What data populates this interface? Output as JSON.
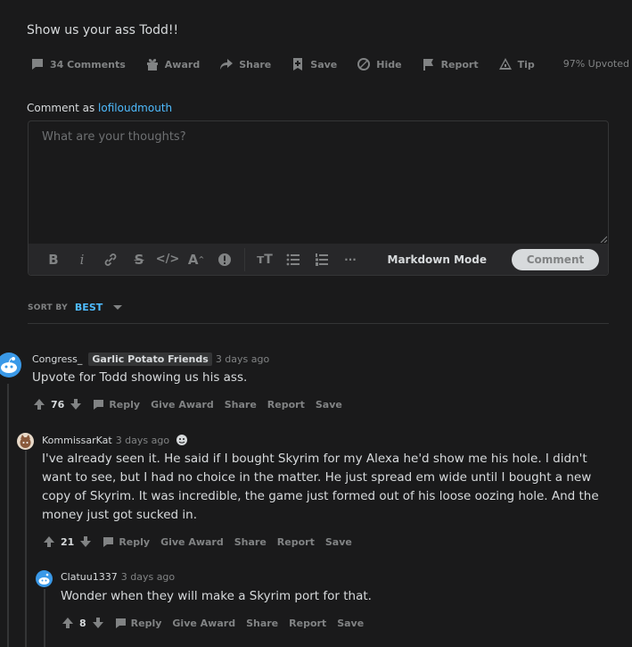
{
  "post": {
    "title": "Show us your ass Todd!!",
    "actions": [
      {
        "icon": "comment-icon",
        "label": "34 Comments"
      },
      {
        "icon": "gift-icon",
        "label": "Award"
      },
      {
        "icon": "share-arrow-icon",
        "label": "Share"
      },
      {
        "icon": "bookmark-icon",
        "label": "Save"
      },
      {
        "icon": "hide-icon",
        "label": "Hide"
      },
      {
        "icon": "flag-icon",
        "label": "Report"
      },
      {
        "icon": "tip-icon",
        "label": "Tip"
      }
    ],
    "upvoted": "97% Upvoted"
  },
  "composer": {
    "comment_as_prefix": "Comment as",
    "username": "lofiloudmouth",
    "placeholder": "What are your thoughts?",
    "toolbar": [
      "B",
      "i",
      "link",
      "S",
      "</>",
      "A^",
      "!",
      "tT",
      "bulleted-list",
      "numbered-list",
      "..."
    ],
    "markdown_mode": "Markdown Mode",
    "submit": "Comment"
  },
  "sort": {
    "label": "SORT BY",
    "value": "BEST"
  },
  "comments": [
    {
      "author": "Congress_",
      "flair": "Garlic Potato Friends",
      "time": "3 days ago",
      "body": "Upvote for Todd showing us his ass.",
      "score": "76",
      "actions": {
        "reply": "Reply",
        "award": "Give Award",
        "share": "Share",
        "report": "Report",
        "save": "Save"
      }
    },
    {
      "author": "KommissarKat",
      "time": "3 days ago",
      "body": "I've already seen it. He said if I bought Skyrim for my Alexa he'd show me his hole. I didn't want to see, but I had no choice in the matter. He just spread em wide until I bought a new copy of Skyrim. It was incredible, the game just formed out of his loose oozing hole. And the money just got sucked in.",
      "score": "21",
      "actions": {
        "reply": "Reply",
        "award": "Give Award",
        "share": "Share",
        "report": "Report",
        "save": "Save"
      }
    },
    {
      "author": "Clatuu1337",
      "time": "3 days ago",
      "body": "Wonder when they will make a Skyrim port for that.",
      "score": "8",
      "actions": {
        "reply": "Reply",
        "award": "Give Award",
        "share": "Share",
        "report": "Report",
        "save": "Save"
      }
    }
  ]
}
